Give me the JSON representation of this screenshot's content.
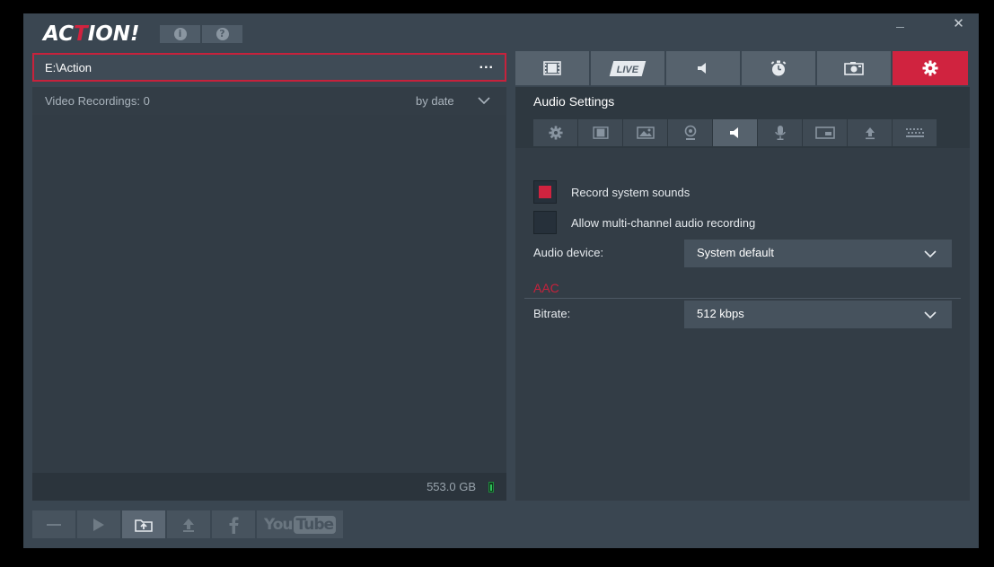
{
  "app": {
    "logo_prefix": "AC",
    "logo_t": "T",
    "logo_suffix": "ION!",
    "info_glyph": "i",
    "help_glyph": "?",
    "close_glyph": "✕"
  },
  "left": {
    "path": "E:\\Action",
    "path_more": "...",
    "recordings_label": "Video Recordings: 0",
    "sort_label": "by date",
    "disk_free": "553.0 GB"
  },
  "bottom_toolbar": {
    "youtube_you": "You",
    "youtube_tube": "Tube"
  },
  "tabs": {
    "live_label": "LIVE"
  },
  "settings": {
    "title": "Audio Settings",
    "record_system_sounds": {
      "label": "Record system sounds",
      "checked": true
    },
    "multichannel": {
      "label": "Allow multi-channel audio recording",
      "checked": false
    },
    "audio_device_label": "Audio device:",
    "audio_device_value": "System default",
    "section_aac": "AAC",
    "bitrate_label": "Bitrate:",
    "bitrate_value": "512 kbps"
  },
  "colors": {
    "accent": "#d0233f",
    "background": "#3a4651",
    "panel": "#333d46",
    "tab": "#56626d"
  },
  "icons": {
    "tabs": [
      "film-icon",
      "live-icon",
      "speaker-icon",
      "stopwatch-icon",
      "camera-icon",
      "gear-icon"
    ],
    "subtabs": [
      "gear-icon",
      "film-icon",
      "image-icon",
      "webcam-icon",
      "speaker-icon",
      "microphone-icon",
      "window-icon",
      "upload-icon",
      "keyboard-icon"
    ],
    "bottom": [
      "minus-icon",
      "play-icon",
      "folder-upload-icon",
      "upload-icon",
      "facebook-icon",
      "youtube-icon"
    ]
  }
}
